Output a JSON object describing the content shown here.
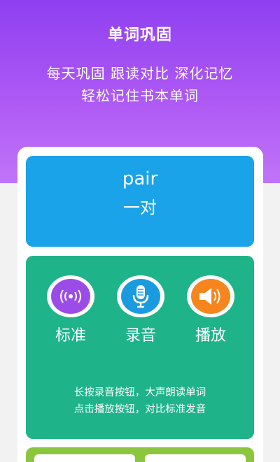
{
  "header": {
    "title": "单词巩固",
    "line1": "每天巩固 跟读对比 深化记忆",
    "line2": "轻松记住书本单词"
  },
  "word_card": {
    "word": "pair",
    "meaning": "一对"
  },
  "actions": [
    {
      "label": "标准",
      "icon": "broadcast-icon"
    },
    {
      "label": "录音",
      "icon": "microphone-icon"
    },
    {
      "label": "播放",
      "icon": "speaker-icon"
    }
  ],
  "hints": {
    "line1": "长按录音按钮，大声朗读单词",
    "line2": "点击播放按钮，对比标准发音"
  },
  "colors": {
    "header": "#8f3ff0",
    "word_panel": "#1aa3e8",
    "practice_panel": "#1fb38a",
    "bottom_panel": "#8cc63f",
    "standard_icon": "#9a4be8",
    "record_icon": "#1a9be0",
    "play_icon": "#f5851c"
  }
}
